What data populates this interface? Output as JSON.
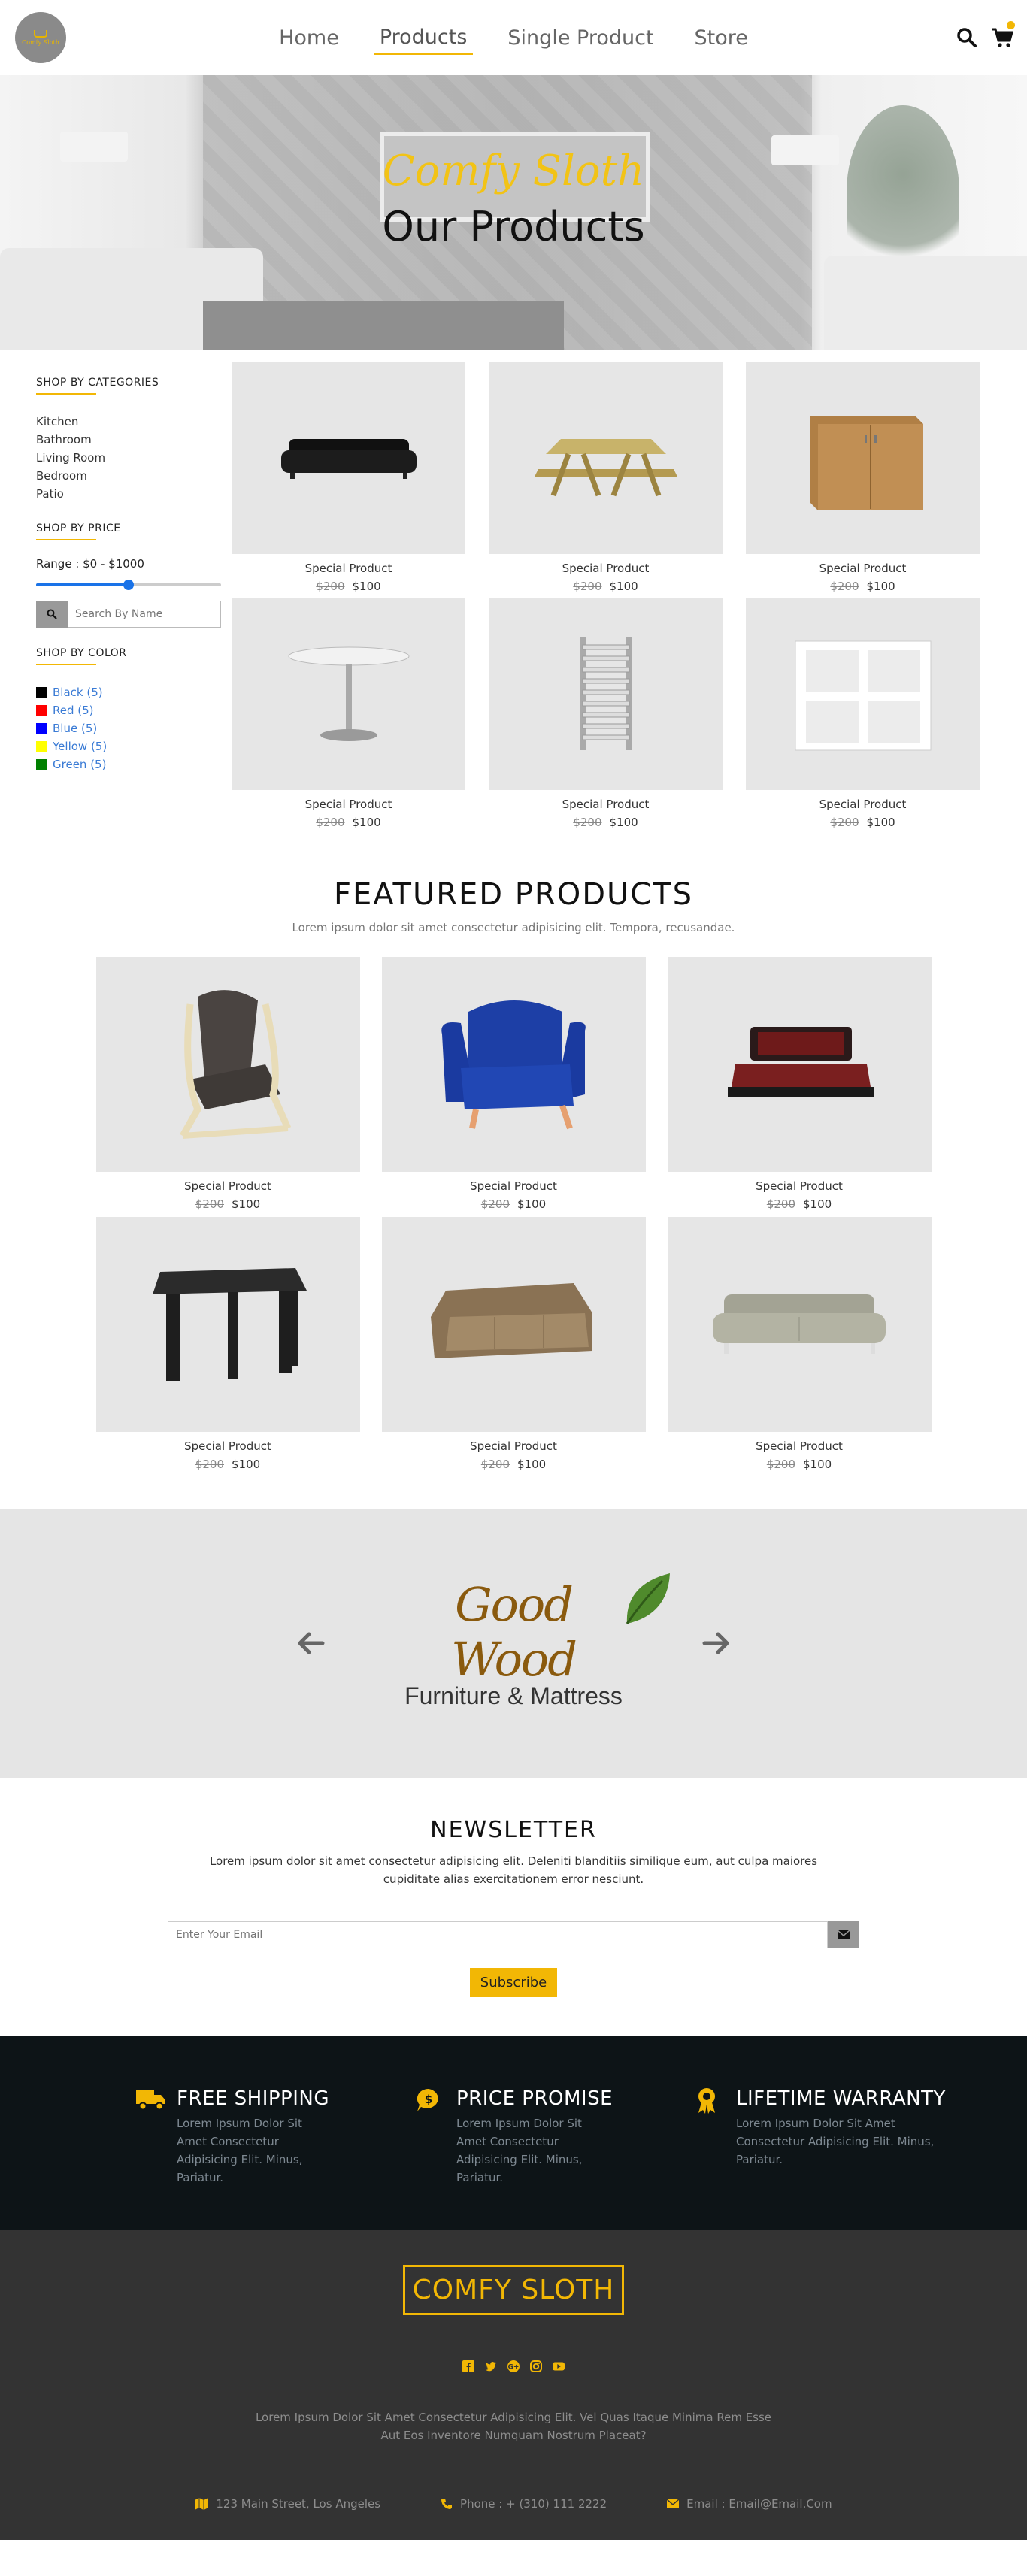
{
  "nav": {
    "logo_text": "Comfy Sloth",
    "links": [
      "Home",
      "Products",
      "Single Product",
      "Store"
    ],
    "active": "Products"
  },
  "hero": {
    "subtitle": "Comfy Sloth",
    "title": "Our Products"
  },
  "sidebar": {
    "categories_heading": "SHOP BY CATEGORIES",
    "categories": [
      "Kitchen",
      "Bathroom",
      "Living Room",
      "Bedroom",
      "Patio"
    ],
    "price_heading": "SHOP BY PRICE",
    "range_label": "Range : $0 - $1000",
    "range_value_fraction": 0.5,
    "search_placeholder": "Search By Name",
    "color_heading": "SHOP BY COLOR",
    "colors": [
      {
        "label": "Black (5)",
        "swatch": "#000000"
      },
      {
        "label": "Red (5)",
        "swatch": "#ff0000"
      },
      {
        "label": "Blue (5)",
        "swatch": "#0000ff"
      },
      {
        "label": "Yellow (5)",
        "swatch": "#ffff00"
      },
      {
        "label": "Green (5)",
        "swatch": "#008000"
      }
    ]
  },
  "products": [
    {
      "name": "Special Product",
      "old_price": "$200",
      "price": "$100",
      "icon": "leather-sofa-image"
    },
    {
      "name": "Special Product",
      "old_price": "$200",
      "price": "$100",
      "icon": "picnic-table-image"
    },
    {
      "name": "Special Product",
      "old_price": "$200",
      "price": "$100",
      "icon": "wood-cabinet-image"
    },
    {
      "name": "Special Product",
      "old_price": "$200",
      "price": "$100",
      "icon": "round-table-image"
    },
    {
      "name": "Special Product",
      "old_price": "$200",
      "price": "$100",
      "icon": "towel-radiator-image"
    },
    {
      "name": "Special Product",
      "old_price": "$200",
      "price": "$100",
      "icon": "cube-shelf-image"
    }
  ],
  "featured": {
    "title": "FEATURED PRODUCTS",
    "subtitle": "Lorem ipsum dolor sit amet consectetur adipisicing elit. Tempora, recusandae.",
    "items": [
      {
        "name": "Special Product",
        "old_price": "$200",
        "price": "$100",
        "icon": "bentwood-chair-image"
      },
      {
        "name": "Special Product",
        "old_price": "$200",
        "price": "$100",
        "icon": "blue-armchair-image"
      },
      {
        "name": "Special Product",
        "old_price": "$200",
        "price": "$100",
        "icon": "bed-frame-image"
      },
      {
        "name": "Special Product",
        "old_price": "$200",
        "price": "$100",
        "icon": "black-side-table-image"
      },
      {
        "name": "Special Product",
        "old_price": "$200",
        "price": "$100",
        "icon": "tan-sofa-image"
      },
      {
        "name": "Special Product",
        "old_price": "$200",
        "price": "$100",
        "icon": "grey-sofa-image"
      }
    ]
  },
  "brand": {
    "line1": "Good Wood",
    "line2": "Furniture & Mattress"
  },
  "newsletter": {
    "title": "NEWSLETTER",
    "text": "Lorem ipsum dolor sit amet consectetur adipisicing elit. Deleniti blanditiis similique eum, aut culpa maiores cupiditate alias exercitationem error nesciunt.",
    "placeholder": "Enter Your Email",
    "button": "Subscribe"
  },
  "features": [
    {
      "title": "FREE SHIPPING",
      "text": "Lorem Ipsum Dolor Sit Amet Consectetur Adipisicing Elit. Minus, Pariatur.",
      "icon": "truck-icon"
    },
    {
      "title": "PRICE PROMISE",
      "text": "Lorem Ipsum Dolor Sit Amet Consectetur Adipisicing Elit. Minus, Pariatur.",
      "icon": "dollar-bubble-icon"
    },
    {
      "title": "LIFETIME WARRANTY",
      "text": "Lorem Ipsum Dolor Sit Amet Consectetur Adipisicing Elit. Minus, Pariatur.",
      "icon": "award-icon"
    }
  ],
  "footer": {
    "logo": "COMFY SLOTH",
    "text": "Lorem Ipsum Dolor Sit Amet Consectetur Adipisicing Elit. Vel Quas Itaque Minima Rem Esse Aut Eos Inventore Numquam Nostrum Placeat?",
    "address": "123 Main Street, Los Angeles",
    "phone": "Phone : + (310) 111 2222",
    "email": "Email : Email@Email.Com"
  },
  "colors": {
    "accent": "#f2b705",
    "dark_strip": "#0d1417",
    "footer_bg": "#333333",
    "card_bg": "#e6e6e6"
  }
}
